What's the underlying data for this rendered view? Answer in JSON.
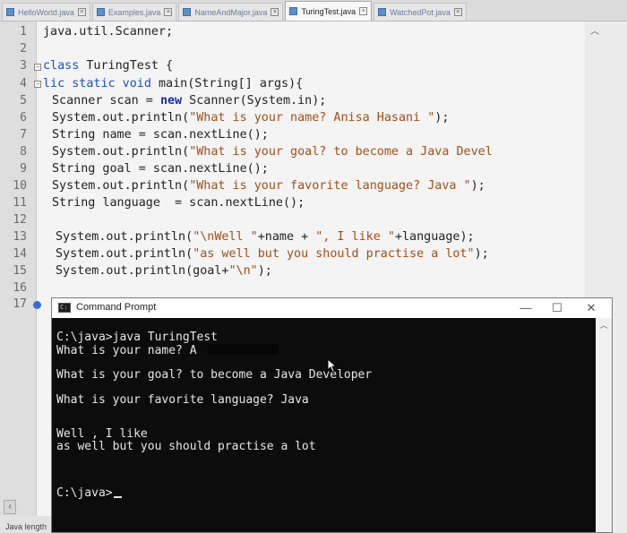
{
  "tabs": [
    {
      "label": "HelloWorld.java",
      "active": false
    },
    {
      "label": "Examples.java",
      "active": false
    },
    {
      "label": "NameAndMajor.java",
      "active": false
    },
    {
      "label": "TuringTest.java",
      "active": true
    },
    {
      "label": "WatchedPot.java",
      "active": false
    }
  ],
  "editor": {
    "lines": [
      {
        "n": "1",
        "text": "java.util.Scanner;"
      },
      {
        "n": "2",
        "text": ""
      },
      {
        "n": "3",
        "text": "class TuringTest {"
      },
      {
        "n": "4",
        "text": "lic static void main(String[] args){"
      },
      {
        "n": "5",
        "text": "Scanner scan = new Scanner(System.in);"
      },
      {
        "n": "6",
        "text": "System.out.println(\"What is your name? Anisa Hasani \");"
      },
      {
        "n": "7",
        "text": "String name = scan.nextLine();"
      },
      {
        "n": "8",
        "text": "System.out.println(\"What is your goal? to become a Java Devel"
      },
      {
        "n": "9",
        "text": "String goal = scan.nextLine();"
      },
      {
        "n": "10",
        "text": "System.out.println(\"What is your favorite language? Java \");"
      },
      {
        "n": "11",
        "text": "String language  = scan.nextLine();"
      },
      {
        "n": "12",
        "text": ""
      },
      {
        "n": "13",
        "text": "System.out.println(\"\\nWell \"+name + \", I like \"+language);"
      },
      {
        "n": "14",
        "text": "System.out.println(\"as well but you should practise a lot\");"
      },
      {
        "n": "15",
        "text": "System.out.println(goal+\"\\n\");"
      },
      {
        "n": "16",
        "text": ""
      },
      {
        "n": "17",
        "text": ""
      }
    ]
  },
  "status": {
    "text": "Java length"
  },
  "cmd": {
    "title": "Command Prompt",
    "minimize": "—",
    "maximize": "☐",
    "close": "✕",
    "lines": [
      "C:\\java>java TuringTest",
      "What is your name? A         i",
      "",
      "What is your goal? to become a Java Developer",
      "",
      "What is your favorite language? Java",
      "",
      "",
      "Well , I like",
      "as well but you should practise a lot",
      "",
      "",
      "",
      "C:\\java>"
    ]
  },
  "colors": {
    "keyword": "#1a4fc9",
    "string": "#a14e17",
    "terminal_bg": "#0c0c0c",
    "terminal_fg": "#e6e6e6"
  }
}
